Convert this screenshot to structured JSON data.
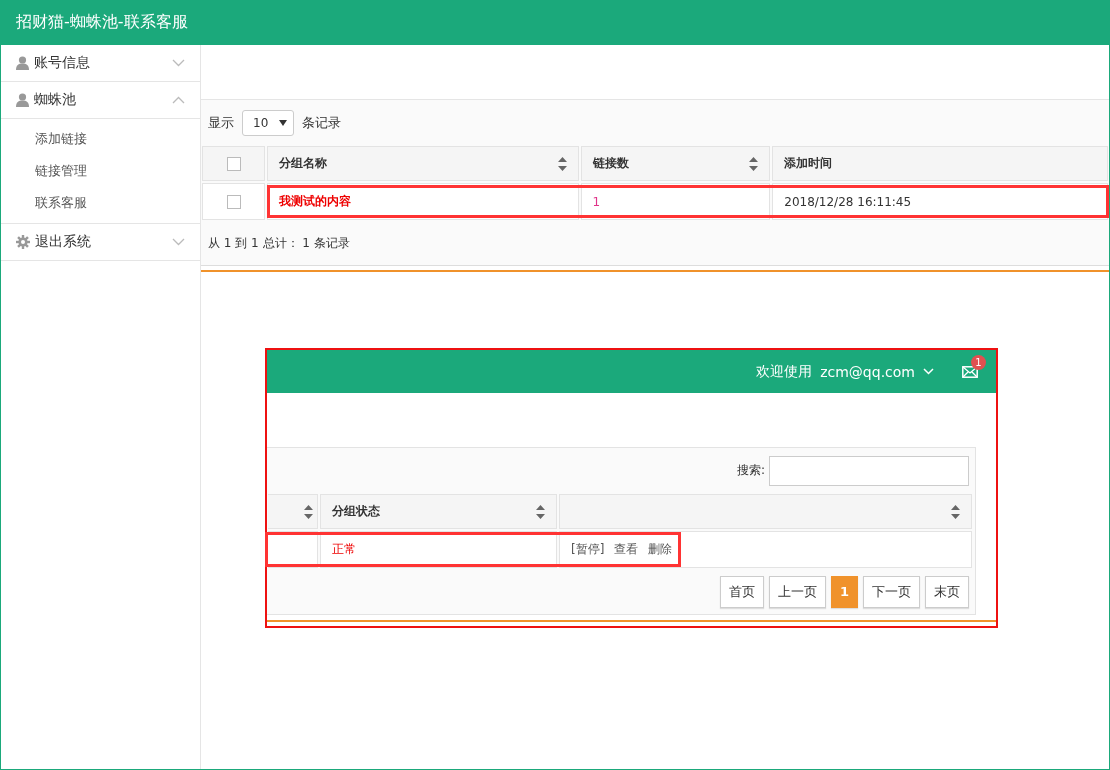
{
  "header": {
    "title": "招财猫-蜘蛛池-联系客服"
  },
  "sidebar": {
    "groups": [
      {
        "label": "账号信息",
        "kind": "user",
        "expanded": false
      },
      {
        "label": "蜘蛛池",
        "kind": "user",
        "expanded": true,
        "children": [
          {
            "label": "添加链接"
          },
          {
            "label": "链接管理"
          },
          {
            "label": "联系客服"
          }
        ]
      },
      {
        "label": "退出系统",
        "kind": "gear",
        "expanded": false
      }
    ]
  },
  "table": {
    "length_prefix": "显示",
    "length_value": "10",
    "length_suffix": "条记录",
    "select_all_checked": false,
    "columns": [
      {
        "label": "分组名称",
        "sortable": true
      },
      {
        "label": "链接数",
        "sortable": true
      },
      {
        "label": "添加时间",
        "sortable": false
      }
    ],
    "rows": [
      {
        "checked": false,
        "highlighted": true,
        "cells": [
          "我测试的内容",
          "1",
          "2018/12/28 16:11:45"
        ]
      }
    ],
    "info": "从 1 到 1 总计： 1 条记录"
  },
  "inset": {
    "welcome": "欢迎使用",
    "user": "zcm@qq.com",
    "badge": "1",
    "search_label": "搜索:",
    "columns": [
      {
        "sortable": true
      },
      {
        "label": "分组状态",
        "sortable": true
      },
      {
        "sortable": true
      }
    ],
    "rows": [
      {
        "highlighted": true,
        "status": "正常",
        "actions": [
          "[暂停]",
          "查看",
          "删除"
        ]
      }
    ],
    "pagination": [
      {
        "label": "首页",
        "selected": false
      },
      {
        "label": "上一页",
        "selected": false
      },
      {
        "label": "1",
        "selected": true
      },
      {
        "label": "下一页",
        "selected": false
      },
      {
        "label": "末页",
        "selected": false
      }
    ]
  }
}
